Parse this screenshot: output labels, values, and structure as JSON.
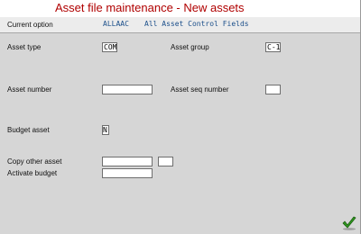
{
  "header": {
    "title": "Asset file maintenance - New assets"
  },
  "current_option": {
    "label": "Current option",
    "code": "ALLAAC",
    "description": "All Asset Control Fields"
  },
  "form": {
    "asset_type": {
      "label": "Asset type",
      "value": "COM"
    },
    "asset_group": {
      "label": "Asset group",
      "value": "C-1"
    },
    "asset_number": {
      "label": "Asset number",
      "value": ""
    },
    "asset_seq_number": {
      "label": "Asset seq number",
      "value": ""
    },
    "budget_asset": {
      "label": "Budget asset",
      "value": "N"
    },
    "copy_other_asset": {
      "label": "Copy other asset",
      "value": "",
      "value2": ""
    },
    "activate_budget": {
      "label": "Activate budget",
      "value": ""
    }
  },
  "actions": {
    "ok_icon": "green-checkmark-icon",
    "ok_color": "#2f9a1e"
  }
}
